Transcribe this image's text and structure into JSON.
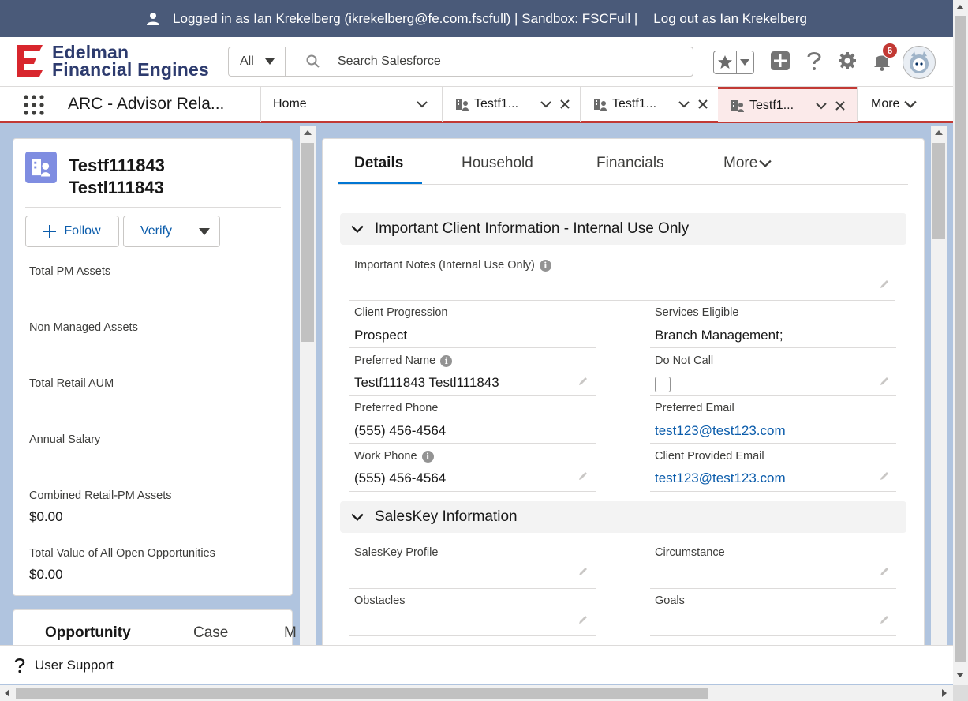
{
  "banner": {
    "logged_in_text": "Logged in as Ian Krekelberg (ikrekelberg@fe.com.fscfull) | Sandbox: FSCFull |",
    "logout_label": "Log out as Ian Krekelberg"
  },
  "header": {
    "logo_line1": "Edelman",
    "logo_line2": "Financial Engines",
    "search_scope": "All",
    "search_placeholder": "Search Salesforce",
    "notification_count": "6"
  },
  "nav": {
    "app_name": "ARC - Advisor Rela...",
    "home_label": "Home",
    "tabs": [
      {
        "label": "Testf1..."
      },
      {
        "label": "Testf1..."
      },
      {
        "label": "Testf1..."
      }
    ],
    "more_label": "More"
  },
  "left": {
    "record_name_line1": "Testf111843",
    "record_name_line2": "Testl111843",
    "follow_label": "Follow",
    "verify_label": "Verify",
    "fields": [
      {
        "label": "Total PM Assets",
        "value": ""
      },
      {
        "label": "Non Managed Assets",
        "value": ""
      },
      {
        "label": "Total Retail AUM",
        "value": ""
      },
      {
        "label": "Annual Salary",
        "value": ""
      },
      {
        "label": "Combined Retail-PM Assets",
        "value": "$0.00"
      },
      {
        "label": "Total Value of All Open Opportunities",
        "value": "$0.00"
      }
    ],
    "related_tabs": [
      "Opportunity",
      "Case",
      "M"
    ]
  },
  "right": {
    "tabs": [
      "Details",
      "Household",
      "Financials",
      "More"
    ],
    "section1_title": "Important Client Information - Internal Use Only",
    "important_notes_label": "Important Notes (Internal Use Only)",
    "client_progression_label": "Client Progression",
    "client_progression_value": "Prospect",
    "services_eligible_label": "Services Eligible",
    "services_eligible_value": "Branch Management;",
    "preferred_name_label": "Preferred Name",
    "preferred_name_value": "Testf111843 Testl111843",
    "do_not_call_label": "Do Not Call",
    "preferred_phone_label": "Preferred Phone",
    "preferred_phone_value": "(555) 456-4564",
    "preferred_email_label": "Preferred Email",
    "preferred_email_value": "test123@test123.com",
    "work_phone_label": "Work Phone",
    "work_phone_value": "(555) 456-4564",
    "client_email_label": "Client Provided Email",
    "client_email_value": "test123@test123.com",
    "section2_title": "SalesKey Information",
    "saleskey_profile_label": "SalesKey Profile",
    "circumstance_label": "Circumstance",
    "obstacles_label": "Obstacles",
    "goals_label": "Goals"
  },
  "utility": {
    "support_label": "User Support"
  },
  "colors": {
    "banner_bg": "#4a5a79",
    "brand_red": "#c23934",
    "brand_navy": "#2d3b6e",
    "link_blue": "#0b5cab",
    "page_bg": "#b0c4df"
  }
}
